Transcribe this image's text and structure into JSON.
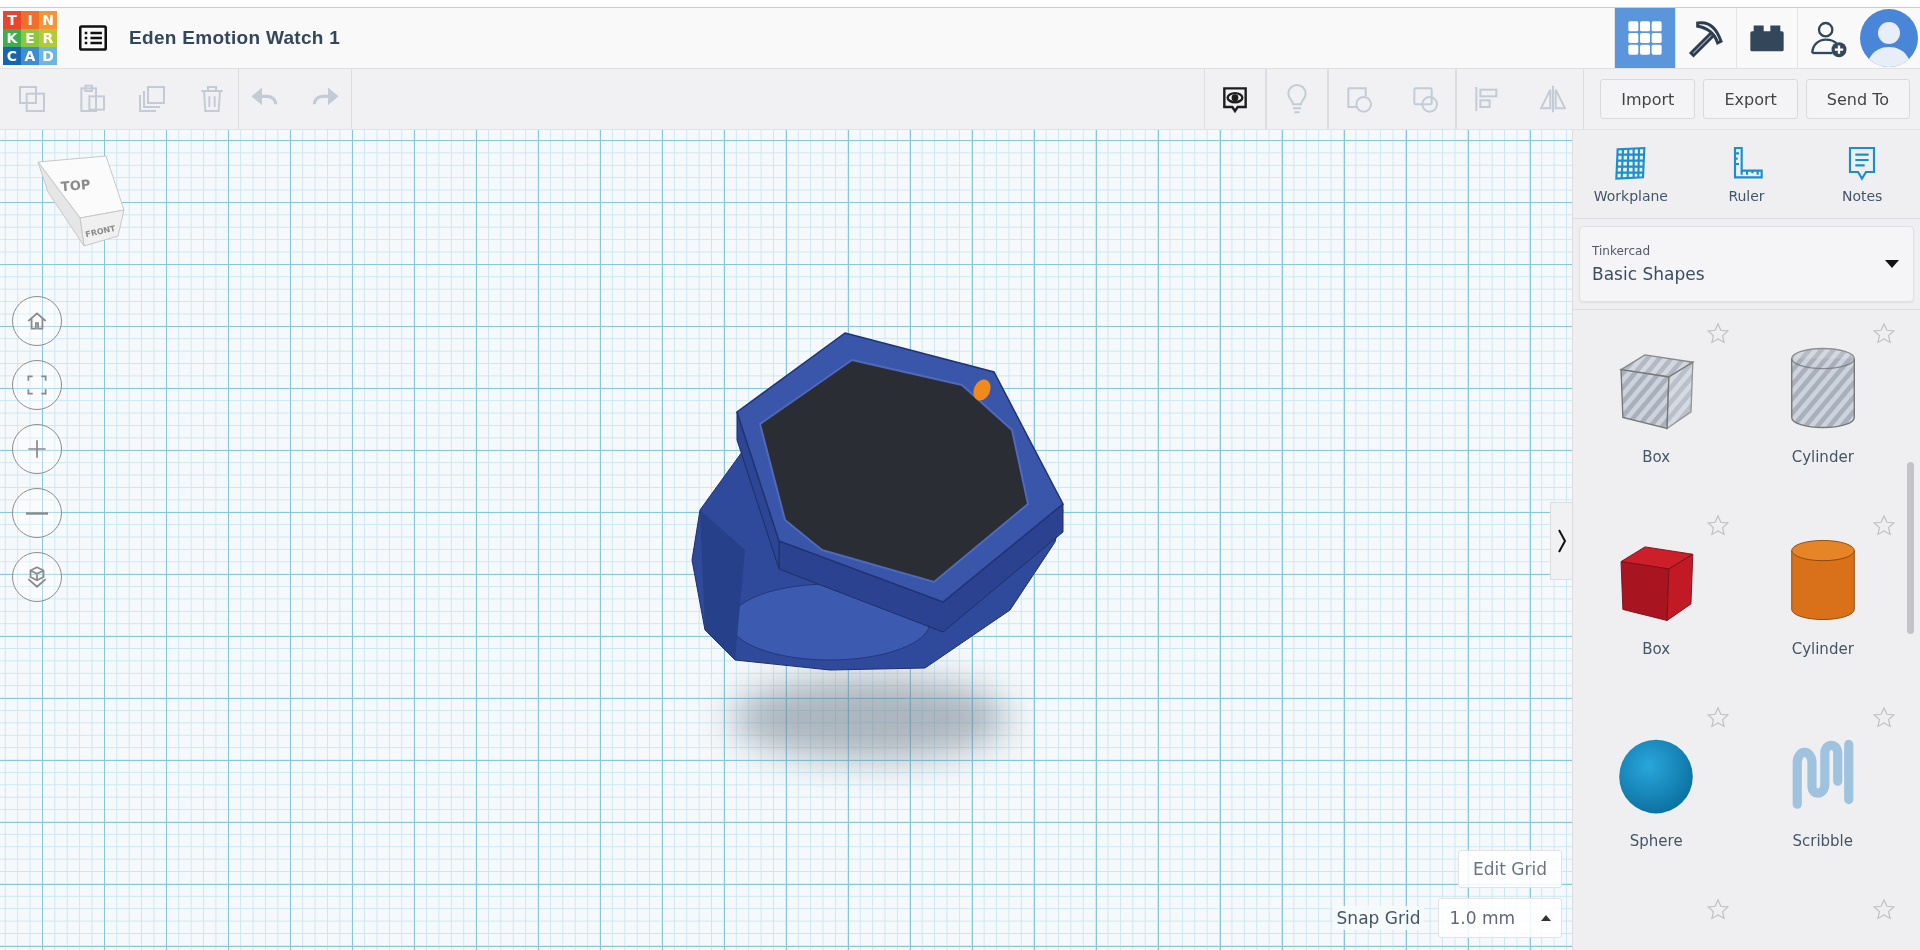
{
  "header": {
    "logo_letters": [
      {
        "text": "T",
        "color": "#e8452c"
      },
      {
        "text": "I",
        "color": "#f26f2b"
      },
      {
        "text": "N",
        "color": "#f79433"
      },
      {
        "text": "K",
        "color": "#3cae4a"
      },
      {
        "text": "E",
        "color": "#8cc63f"
      },
      {
        "text": "R",
        "color": "#b5c934"
      },
      {
        "text": "C",
        "color": "#1565b0"
      },
      {
        "text": "A",
        "color": "#3d8dd0"
      },
      {
        "text": "D",
        "color": "#6db5e2"
      }
    ],
    "title": "Eden Emotion Watch 1",
    "view_buttons": [
      {
        "kind": "grid",
        "selected": true
      },
      {
        "kind": "pickaxe",
        "selected": false
      },
      {
        "kind": "brick",
        "selected": false
      }
    ]
  },
  "toolbar": {
    "edit_tools": [
      {
        "kind": "copy",
        "disabled": true
      },
      {
        "kind": "paste",
        "disabled": true
      },
      {
        "kind": "duplicate",
        "disabled": true
      },
      {
        "kind": "delete",
        "disabled": true
      },
      {
        "kind": "undo",
        "disabled": true
      },
      {
        "kind": "redo",
        "disabled": true
      }
    ],
    "shape_tools": [
      {
        "kind": "notes-toggle",
        "disabled": false
      },
      {
        "kind": "bulb",
        "disabled": true
      },
      {
        "kind": "union",
        "disabled": true
      },
      {
        "kind": "subtract",
        "disabled": true
      },
      {
        "kind": "align",
        "disabled": true
      },
      {
        "kind": "mirror",
        "disabled": true
      }
    ],
    "buttons": [
      "Import",
      "Export",
      "Send To"
    ]
  },
  "canvas": {
    "view_cube": {
      "top": "TOP",
      "front": "FRONT"
    },
    "edit_grid": "Edit Grid",
    "snap_grid": {
      "label": "Snap Grid",
      "value": "1.0 mm"
    }
  },
  "panel": {
    "tools": [
      {
        "kind": "workplane",
        "label": "Workplane"
      },
      {
        "kind": "ruler",
        "label": "Ruler"
      },
      {
        "kind": "notes",
        "label": "Notes"
      }
    ],
    "library": {
      "source": "Tinkercad",
      "category": "Basic Shapes"
    },
    "shapes": [
      {
        "kind": "box-hole",
        "label": "Box",
        "favorite": false
      },
      {
        "kind": "cylinder-hole",
        "label": "Cylinder",
        "favorite": false
      },
      {
        "kind": "box",
        "label": "Box",
        "favorite": false
      },
      {
        "kind": "cylinder",
        "label": "Cylinder",
        "favorite": false
      },
      {
        "kind": "sphere",
        "label": "Sphere",
        "favorite": false
      },
      {
        "kind": "scribble",
        "label": "Scribble",
        "favorite": false
      },
      {
        "kind": "partial",
        "favorite": false
      },
      {
        "kind": "partial",
        "favorite": false
      }
    ]
  }
}
